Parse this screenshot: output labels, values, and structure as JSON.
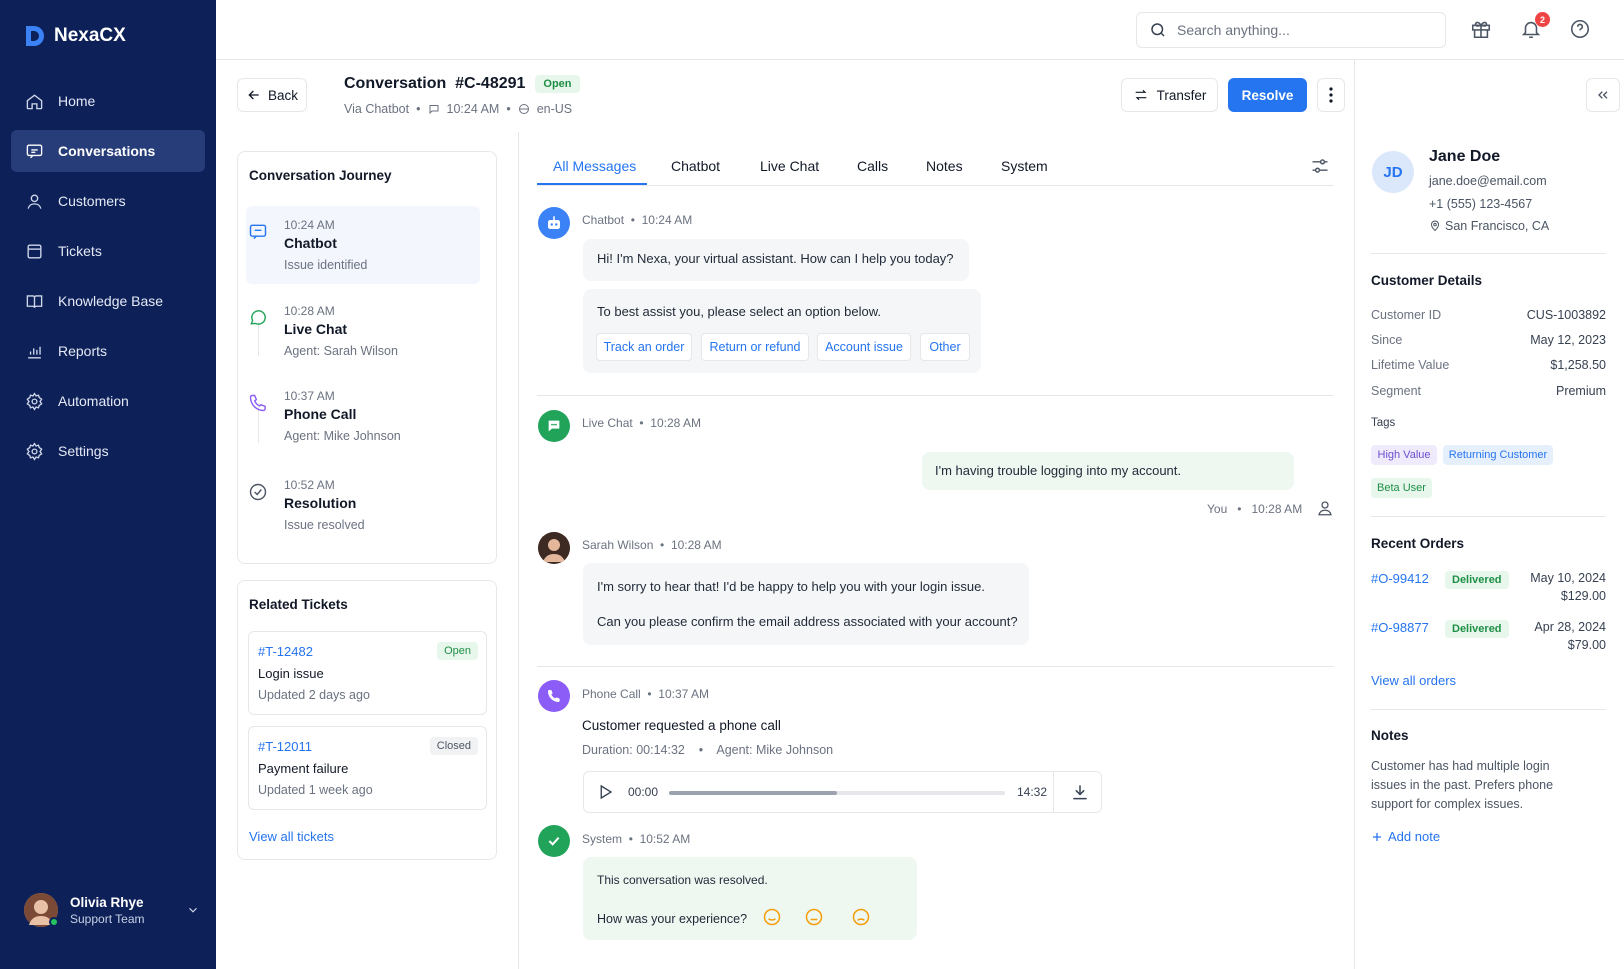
{
  "app": {
    "name": "NexaCX"
  },
  "sidebar": {
    "items": [
      {
        "label": "Home",
        "icon": "home-icon"
      },
      {
        "label": "Conversations",
        "icon": "chat-icon",
        "active": true
      },
      {
        "label": "Customers",
        "icon": "user-icon"
      },
      {
        "label": "Tickets",
        "icon": "ticket-icon"
      },
      {
        "label": "Knowledge Base",
        "icon": "book-icon"
      },
      {
        "label": "Reports",
        "icon": "chart-icon"
      },
      {
        "label": "Automation",
        "icon": "gear-icon"
      },
      {
        "label": "Settings",
        "icon": "gear-icon"
      }
    ],
    "user": {
      "name": "Olivia Rhye",
      "team": "Support Team"
    }
  },
  "header": {
    "search_placeholder": "Search anything...",
    "notification_count": "2"
  },
  "conversation": {
    "back_label": "Back",
    "title": "Conversation  #C-48291",
    "status": "Open",
    "via": "Via Chatbot",
    "time": "10:24 AM",
    "locale": "en-US",
    "transfer_label": "Transfer",
    "resolve_label": "Resolve"
  },
  "journey": {
    "title": "Conversation Journey",
    "steps": [
      {
        "time": "10:24 AM",
        "name": "Chatbot",
        "sub": "Issue identified"
      },
      {
        "time": "10:28 AM",
        "name": "Live Chat",
        "sub": "Agent: Sarah Wilson"
      },
      {
        "time": "10:37 AM",
        "name": "Phone Call",
        "sub": "Agent: Mike Johnson"
      },
      {
        "time": "10:52 AM",
        "name": "Resolution",
        "sub": "Issue resolved"
      }
    ]
  },
  "related": {
    "title": "Related Tickets",
    "tickets": [
      {
        "id": "#T-12482",
        "status": "Open",
        "name": "Login issue",
        "updated": "Updated 2 days ago"
      },
      {
        "id": "#T-12011",
        "status": "Closed",
        "name": "Payment failure",
        "updated": "Updated 1 week ago"
      }
    ],
    "view_all": "View all tickets"
  },
  "tabs": [
    "All Messages",
    "Chatbot",
    "Live Chat",
    "Calls",
    "Notes",
    "System"
  ],
  "messages": {
    "chatbot": {
      "sender": "Chatbot",
      "time": "10:24 AM",
      "text1": "Hi! I'm Nexa, your virtual assistant. How can I help you today?",
      "text2": "To best assist you, please select an option below.",
      "options": [
        "Track an order",
        "Return or refund",
        "Account issue",
        "Other"
      ]
    },
    "livechat": {
      "sender": "Live Chat",
      "time": "10:28 AM",
      "user_text": "I'm having trouble logging into my account.",
      "user_sender": "You",
      "user_time": "10:28 AM"
    },
    "agent": {
      "sender": "Sarah Wilson",
      "time": "10:28 AM",
      "text1": "I'm sorry to hear that! I'd be happy to help you with your login issue.",
      "text2": "Can you please confirm the email address associated with your account?"
    },
    "call": {
      "sender": "Phone Call",
      "time": "10:37 AM",
      "title": "Customer requested a phone call",
      "duration": "Duration: 00:14:32",
      "agent": "Agent: Mike Johnson",
      "current": "00:00",
      "total": "14:32",
      "progress": 0.5
    },
    "system": {
      "sender": "System",
      "time": "10:52 AM",
      "text1": "This conversation was resolved.",
      "text2": "How was your experience?"
    }
  },
  "customer": {
    "initials": "JD",
    "name": "Jane Doe",
    "email": "jane.doe@email.com",
    "phone": "+1 (555) 123-4567",
    "location": "San Francisco, CA",
    "details_title": "Customer Details",
    "details": [
      {
        "label": "Customer ID",
        "value": "CUS-1003892"
      },
      {
        "label": "Since",
        "value": "May 12, 2023"
      },
      {
        "label": "Lifetime Value",
        "value": "$1,258.50"
      },
      {
        "label": "Segment",
        "value": "Premium"
      }
    ],
    "tags_title": "Tags",
    "tags": [
      "High Value",
      "Returning Customer",
      "Beta User"
    ],
    "orders_title": "Recent Orders",
    "orders": [
      {
        "id": "#O-99412",
        "status": "Delivered",
        "date": "May 10, 2024",
        "amount": "$129.00"
      },
      {
        "id": "#O-98877",
        "status": "Delivered",
        "date": "Apr 28, 2024",
        "amount": "$79.00"
      }
    ],
    "view_orders": "View all orders",
    "notes_title": "Notes",
    "notes_text": "Customer has had multiple login issues in the past. Prefers phone support for complex issues.",
    "add_note": "Add note"
  },
  "colors": {
    "primary": "#2574f0",
    "sidebar": "#0d2158",
    "success": "#22a35a",
    "call": "#8b5cf6"
  }
}
